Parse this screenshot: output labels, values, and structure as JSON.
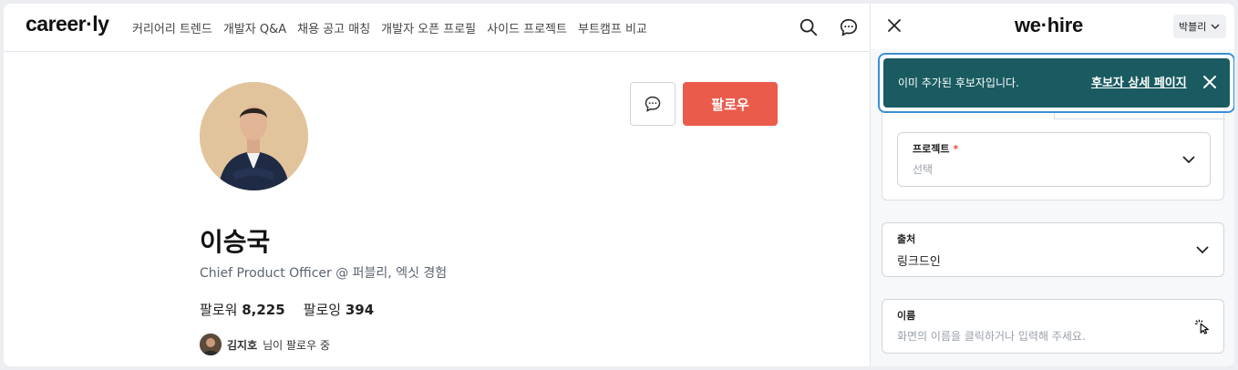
{
  "careerly": {
    "logo": "career·ly",
    "nav": [
      "커리어리 트렌드",
      "개발자 Q&A",
      "채용 공고 매칭",
      "개발자 오픈 프로필",
      "사이드 프로젝트",
      "부트캠프 비교"
    ],
    "follow_label": "팔로우",
    "profile": {
      "name": "이승국",
      "title": "Chief Product Officer @ 퍼블리, 엑싯 경험",
      "followers_label": "팔로워",
      "followers": "8,225",
      "following_label": "팔로잉",
      "following": "394",
      "mutual_name": "김지호",
      "mutual_suffix": "님이 팔로우 중"
    },
    "icons": [
      "search-icon",
      "chat-icon",
      "chat-icon"
    ]
  },
  "wehire": {
    "brand": "we·hire",
    "user": "박블리",
    "toast": {
      "message": "이미 추가된 후보자입니다.",
      "link": "후보자 상세 페이지"
    },
    "fields": {
      "project": {
        "label": "프로젝트",
        "placeholder": "선택"
      },
      "source": {
        "label": "출처",
        "value": "링크드인"
      },
      "name": {
        "label": "이름",
        "placeholder": "화면의 이름을 클릭하거나  입력해 주세요."
      }
    },
    "colors": {
      "toast_bg": "#1a5b61",
      "focus_ring": "#3a8fd9",
      "follow_bg": "#ea5b4c",
      "required": "#e84a3c"
    }
  }
}
